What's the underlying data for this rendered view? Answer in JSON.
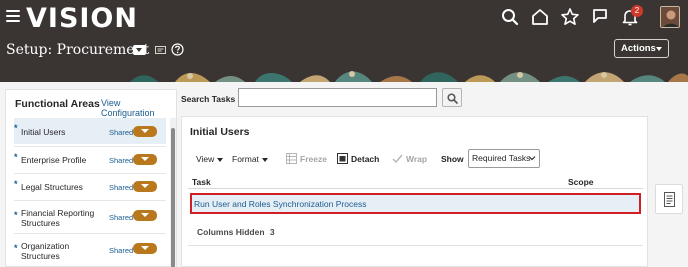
{
  "header": {
    "logo": "VISION",
    "notification_count": "2",
    "page_title": "Setup: Procurement",
    "actions_label": "Actions"
  },
  "functional_areas": {
    "title": "Functional Areas",
    "view_config_label": "View Configuration",
    "items": [
      {
        "star": "*",
        "label": "Initial Users",
        "status": "Shared"
      },
      {
        "star": "*",
        "label": "Enterprise Profile",
        "status": "Shared"
      },
      {
        "star": "*",
        "label": "Legal Structures",
        "status": "Shared"
      },
      {
        "star": "*",
        "label": "Financial Reporting Structures",
        "status": "Shared"
      },
      {
        "star": "*",
        "label": "Organization Structures",
        "status": "Shared"
      }
    ]
  },
  "search": {
    "label": "Search Tasks",
    "value": "",
    "placeholder": ""
  },
  "main": {
    "title": "Initial Users",
    "toolbar": {
      "view_label": "View",
      "format_label": "Format",
      "freeze_label": "Freeze",
      "detach_label": "Detach",
      "wrap_label": "Wrap",
      "show_label": "Show",
      "show_selected": "Required Tasks"
    },
    "columns": [
      "Task",
      "Scope"
    ],
    "rows": [
      {
        "task": "Run User and Roles Synchronization Process",
        "scope": ""
      }
    ],
    "columns_hidden_label": "Columns Hidden",
    "columns_hidden_count": "3"
  },
  "colors": {
    "header_bg": "#3a3532",
    "link": "#1a5c8e",
    "highlight_border": "#d21f26",
    "selected_row": "#e6eef6",
    "shared_button": "#b8781b",
    "badge": "#d0382a"
  },
  "icons": [
    "menu-icon",
    "search-icon",
    "home-icon",
    "star-icon",
    "flag-icon",
    "bell-icon",
    "dropdown-icon",
    "comment-icon",
    "help-icon",
    "freeze-icon",
    "detach-icon",
    "wrap-icon",
    "document-icon"
  ]
}
